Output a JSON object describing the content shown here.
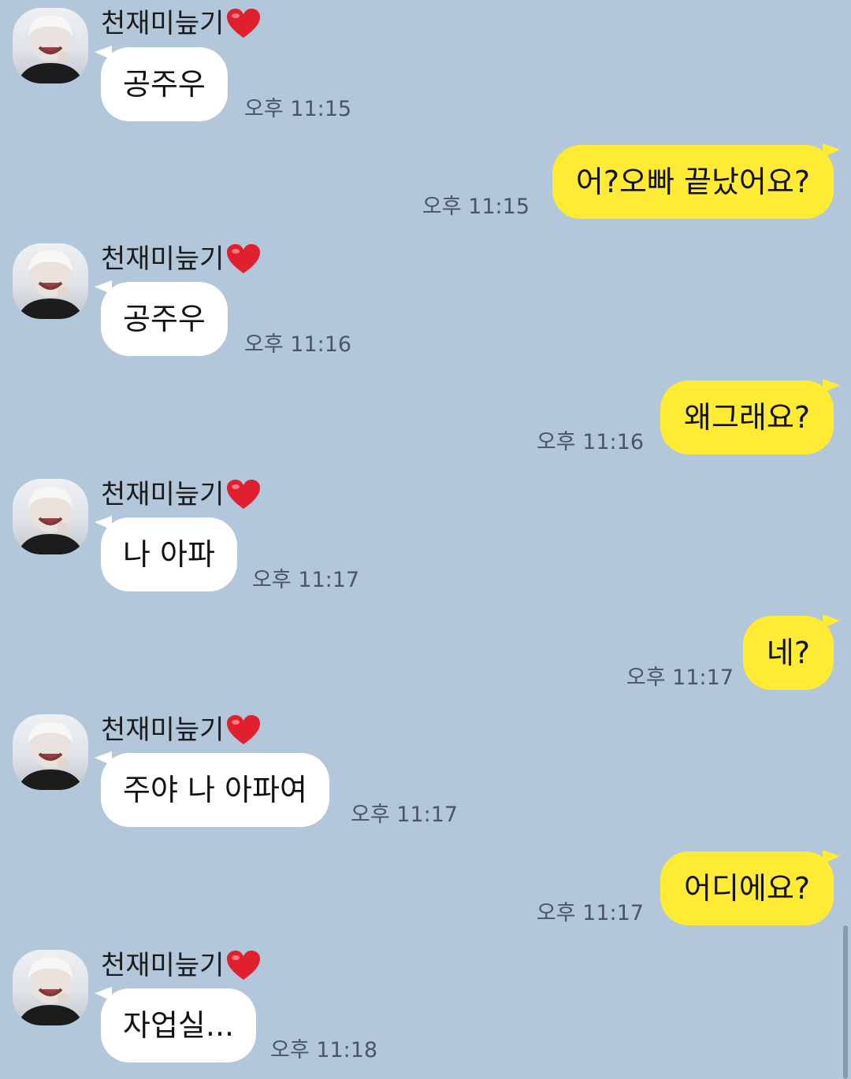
{
  "colors": {
    "background": "#b2c7d9",
    "incoming_bubble": "#ffffff",
    "outgoing_bubble": "#ffeb33",
    "heart": "#e0202e"
  },
  "sender": {
    "name": "천재미늪기",
    "heart_icon": "red-heart-emoji",
    "avatar_icon": "profile-photo"
  },
  "messages": [
    {
      "direction": "in",
      "text": "공주우",
      "time": "오후 11:15"
    },
    {
      "direction": "out",
      "text": "어?오빠 끝났어요?",
      "time": "오후 11:15"
    },
    {
      "direction": "in",
      "text": "공주우",
      "time": "오후 11:16"
    },
    {
      "direction": "out",
      "text": "왜그래요?",
      "time": "오후 11:16"
    },
    {
      "direction": "in",
      "text": "나 아파",
      "time": "오후 11:17"
    },
    {
      "direction": "out",
      "text": "네?",
      "time": "오후 11:17"
    },
    {
      "direction": "in",
      "text": "주야 나 아파여",
      "time": "오후 11:17"
    },
    {
      "direction": "out",
      "text": "어디에요?",
      "time": "오후 11:17"
    },
    {
      "direction": "in",
      "text": "자업실...",
      "time": "오후 11:18"
    }
  ]
}
